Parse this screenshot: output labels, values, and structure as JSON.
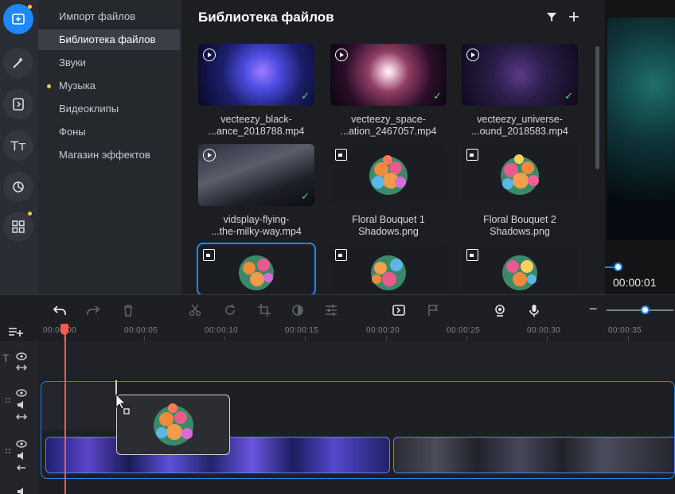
{
  "rail": {
    "items": [
      {
        "icon": "import-file-icon",
        "active": true
      },
      {
        "icon": "magic-wand-icon"
      },
      {
        "icon": "transitions-icon"
      },
      {
        "icon": "text-titles-icon",
        "glyph": "Tт"
      },
      {
        "icon": "color-filter-icon"
      },
      {
        "icon": "more-tools-grid-icon"
      }
    ]
  },
  "menu": {
    "items": [
      {
        "label": "Импорт файлов"
      },
      {
        "label": "Библиотека файлов",
        "active": true
      },
      {
        "label": "Звуки"
      },
      {
        "label": "Музыка",
        "dot": true
      },
      {
        "label": "Видеоклипы"
      },
      {
        "label": "Фоны"
      },
      {
        "label": "Магазин эффектов"
      }
    ]
  },
  "library": {
    "title": "Библиотека файлов",
    "files": [
      {
        "name_line1": "vecteezy_black-",
        "name_line2": "...ance_2018788.mp4",
        "kind": "video",
        "added": true
      },
      {
        "name_line1": "vecteezy_space-",
        "name_line2": "...ation_2467057.mp4",
        "kind": "video",
        "added": true
      },
      {
        "name_line1": "vecteezy_universe-",
        "name_line2": "...ound_2018583.mp4",
        "kind": "video",
        "added": true
      },
      {
        "name_line1": "vidsplay-flying-",
        "name_line2": "...the-milky-way.mp4",
        "kind": "video",
        "added": true
      },
      {
        "name_line1": "Floral Bouquet 1",
        "name_line2": "Shadows.png",
        "kind": "image"
      },
      {
        "name_line1": "Floral Bouquet 2",
        "name_line2": "Shadows.png",
        "kind": "image"
      },
      {
        "kind": "image",
        "selected": true
      },
      {
        "kind": "image"
      },
      {
        "kind": "image"
      }
    ]
  },
  "preview": {
    "time": "00:00:01"
  },
  "timeline": {
    "ruler": [
      "00:00:00",
      "00:00:05",
      "00:00:10",
      "00:00:15",
      "00:00:20",
      "00:00:25",
      "00:00:30",
      "00:00:35"
    ],
    "zoom_minus": "−",
    "colors": {
      "accent": "#1e88ff",
      "playhead": "#ff5a4e",
      "check": "#4cd964",
      "dot": "#f5c842"
    }
  }
}
